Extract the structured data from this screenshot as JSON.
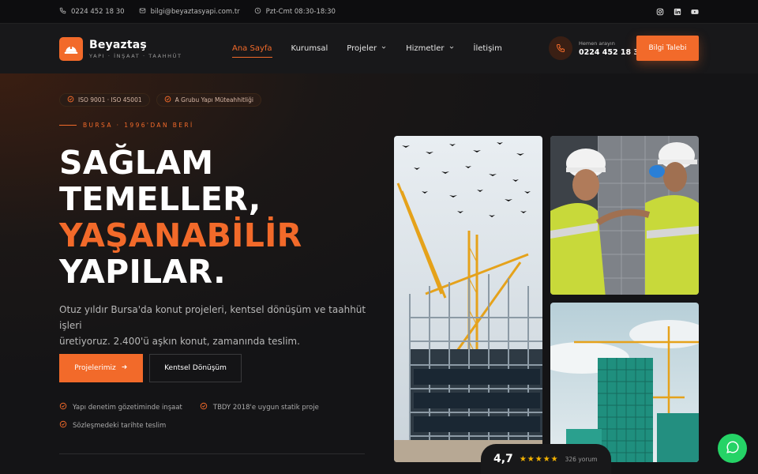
{
  "topbar": {
    "phone": "0224 452 18 30",
    "email": "bilgi@beyaztasyapi.com.tr",
    "hours": "Pzt-Cmt 08:30-18:30",
    "social": [
      "instagram-icon",
      "linkedin-icon",
      "youtube-icon"
    ]
  },
  "brand": {
    "name": "Beyaztaş",
    "tagline": "YAPI · İNŞAAT · TAAHHÜT"
  },
  "nav": {
    "items": [
      {
        "label": "Ana Sayfa",
        "active": true
      },
      {
        "label": "Kurumsal"
      },
      {
        "label": "Projeler",
        "dropdown": true
      },
      {
        "label": "Hizmetler",
        "dropdown": true
      },
      {
        "label": "İletişim"
      }
    ]
  },
  "call": {
    "small": "Hemen arayın",
    "number": "0224 452 18 30"
  },
  "cta": "Bilgi Talebi",
  "hero": {
    "badges": [
      "ISO 9001 · ISO 45001",
      "A Grubu Yapı Müteahhitliği"
    ],
    "eyebrow": "BURSA · 1996'DAN BERİ",
    "title_lines": [
      "SAĞLAM",
      "TEMELLER,",
      "YAŞANABİLİR",
      "YAPILAR."
    ],
    "desc_line1": "Otuz yıldır Bursa'da konut projeleri, kentsel dönüşüm ve taahhüt işleri",
    "desc_line2": "üretiyoruz. 2.400'ü aşkın konut, zamanında teslim.",
    "btn_primary": "Projelerimiz",
    "btn_secondary": "Kentsel Dönüşüm",
    "checks": [
      "Yapı denetim gözetiminde inşaat",
      "TBDY 2018'e uygun statik proje",
      "Sözleşmedeki tarihte teslim"
    ]
  },
  "rating": {
    "value": "4,7",
    "stars": "★★★★★",
    "count": "326 yorum"
  },
  "colors": {
    "accent": "#f26a2a",
    "bg": "#141416"
  }
}
